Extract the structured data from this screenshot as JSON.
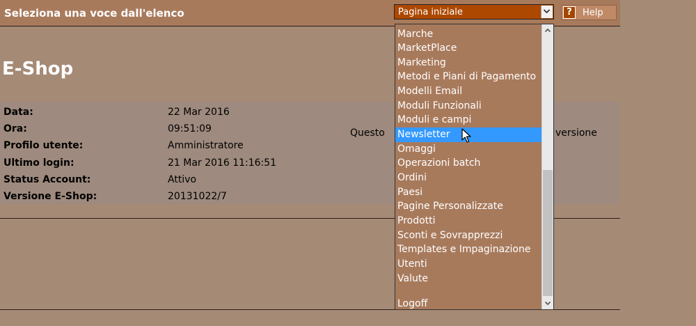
{
  "topbar": {
    "title": "Seleziona una voce dall'elenco",
    "select_value": "Pagina iniziale",
    "help_label": "Help",
    "help_icon_glyph": "?"
  },
  "heading": "E-Shop",
  "info": {
    "rows": [
      {
        "label": "Data:",
        "value": "22 Mar 2016"
      },
      {
        "label": "Ora:",
        "value": "09:51:09"
      },
      {
        "label": "Profilo utente:",
        "value": "Amministratore"
      },
      {
        "label": "Ultimo login:",
        "value": "21 Mar 2016 11:16:51"
      },
      {
        "label": "Status Account:",
        "value": "Attivo"
      },
      {
        "label": "Versione E-Shop:",
        "value": "20131022/7"
      }
    ],
    "text_left": "Questo",
    "text_right": "versione"
  },
  "dropdown": {
    "items": [
      {
        "label": "Marche",
        "selected": false
      },
      {
        "label": "MarketPlace",
        "selected": false
      },
      {
        "label": "Marketing",
        "selected": false
      },
      {
        "label": "Metodi e Piani di Pagamento",
        "selected": false
      },
      {
        "label": "Modelli Email",
        "selected": false
      },
      {
        "label": "Moduli Funzionali",
        "selected": false
      },
      {
        "label": "Moduli e campi",
        "selected": false
      },
      {
        "label": "Newsletter",
        "selected": true
      },
      {
        "label": "Omaggi",
        "selected": false
      },
      {
        "label": "Operazioni batch",
        "selected": false
      },
      {
        "label": "Ordini",
        "selected": false
      },
      {
        "label": "Paesi",
        "selected": false
      },
      {
        "label": "Pagine Personalizzate",
        "selected": false
      },
      {
        "label": "Prodotti",
        "selected": false
      },
      {
        "label": "Sconti e Sovrapprezzi",
        "selected": false
      },
      {
        "label": "Templates e Impaginazione",
        "selected": false
      },
      {
        "label": "Utenti",
        "selected": false
      },
      {
        "label": "Valute",
        "selected": false
      },
      {
        "label": "",
        "selected": false
      },
      {
        "label": "Logoff",
        "selected": false
      }
    ]
  },
  "colors": {
    "page_bg": "#a58a76",
    "topbar_bg": "#a87a5c",
    "select_bg": "#ad4800",
    "panel_bg": "#9e8a7e",
    "highlight": "#3399ff"
  },
  "icons": {
    "select_arrow": "chevron-down-icon",
    "scroll_up": "chevron-up-icon",
    "scroll_down": "chevron-down-icon",
    "help": "question-mark-icon",
    "cursor": "mouse-pointer-icon"
  }
}
